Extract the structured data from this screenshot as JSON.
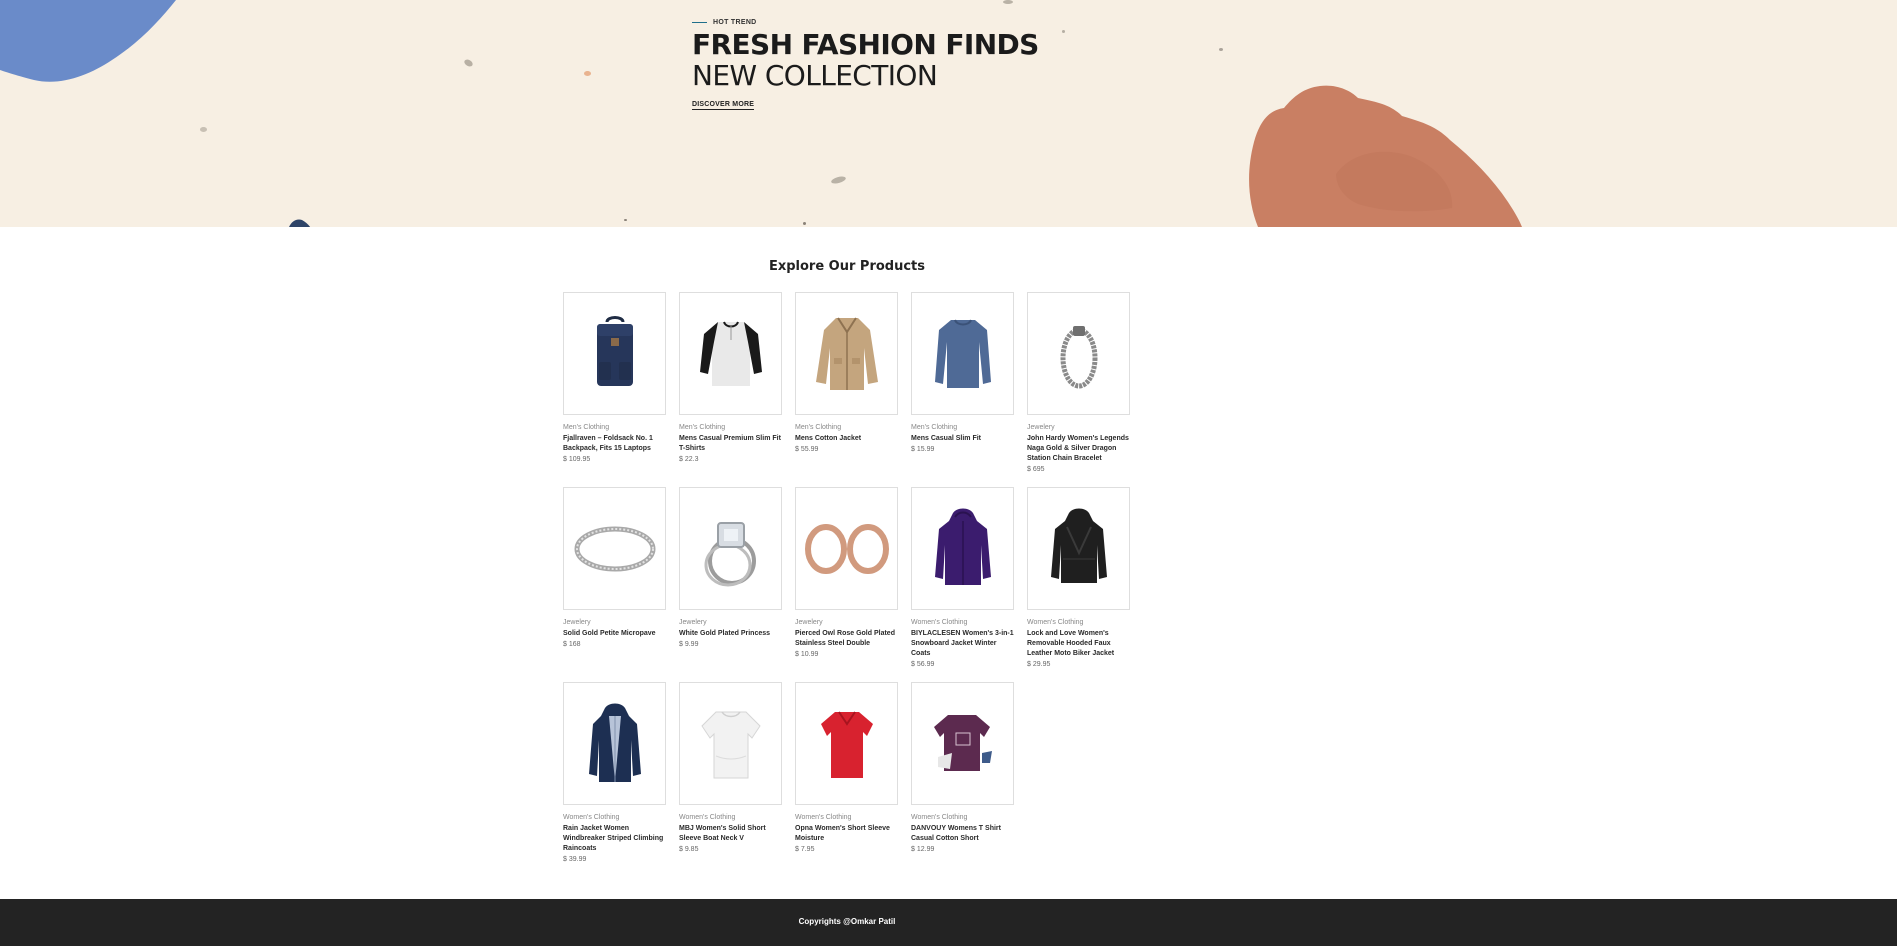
{
  "hero": {
    "tag": "HOT TREND",
    "title_line1": "FRESH FASHION FINDS",
    "title_line2": "NEW COLLECTION",
    "cta_label": "DISCOVER MORE",
    "colors": {
      "background": "#f7efe3",
      "blue_blob": "#6a8bc9",
      "rock": "#c97f63"
    }
  },
  "products": {
    "section_title": "Explore Our Products",
    "items": [
      {
        "category": "Men's Clothing",
        "name": "Fjallraven – Foldsack No. 1 Backpack, Fits 15 Laptops",
        "price": "$ 109.95",
        "icon": "backpack-image"
      },
      {
        "category": "Men's Clothing",
        "name": "Mens Casual Premium Slim Fit T-Shirts",
        "price": "$ 22.3",
        "icon": "raglan-tshirt-image"
      },
      {
        "category": "Men's Clothing",
        "name": "Mens Cotton Jacket",
        "price": "$ 55.99",
        "icon": "cotton-jacket-image"
      },
      {
        "category": "Men's Clothing",
        "name": "Mens Casual Slim Fit",
        "price": "$ 15.99",
        "icon": "longsleeve-shirt-image"
      },
      {
        "category": "Jewelery",
        "name": "John Hardy Women's Legends Naga Gold & Silver Dragon Station Chain Bracelet",
        "price": "$ 695",
        "icon": "bracelet-image"
      },
      {
        "category": "Jewelery",
        "name": "Solid Gold Petite Micropave",
        "price": "$ 168",
        "icon": "ring-band-image"
      },
      {
        "category": "Jewelery",
        "name": "White Gold Plated Princess",
        "price": "$ 9.99",
        "icon": "diamond-ring-image"
      },
      {
        "category": "Jewelery",
        "name": "Pierced Owl Rose Gold Plated Stainless Steel Double",
        "price": "$ 10.99",
        "icon": "plugs-image"
      },
      {
        "category": "Women's Clothing",
        "name": "BIYLACLESEN Women's 3-in-1 Snowboard Jacket Winter Coats",
        "price": "$ 56.99",
        "icon": "purple-jacket-image"
      },
      {
        "category": "Women's Clothing",
        "name": "Lock and Love Women's Removable Hooded Faux Leather Moto Biker Jacket",
        "price": "$ 29.95",
        "icon": "biker-jacket-image"
      },
      {
        "category": "Women's Clothing",
        "name": "Rain Jacket Women Windbreaker Striped Climbing Raincoats",
        "price": "$ 39.99",
        "icon": "rain-jacket-image"
      },
      {
        "category": "Women's Clothing",
        "name": "MBJ Women's Solid Short Sleeve Boat Neck V",
        "price": "$ 9.85",
        "icon": "white-top-image"
      },
      {
        "category": "Women's Clothing",
        "name": "Opna Women's Short Sleeve Moisture",
        "price": "$ 7.95",
        "icon": "red-tshirt-image"
      },
      {
        "category": "Women's Clothing",
        "name": "DANVOUY Womens T Shirt Casual Cotton Short",
        "price": "$ 12.99",
        "icon": "purple-tshirt-image"
      }
    ]
  },
  "footer": {
    "copyright": "Copyrights @Omkar Patil"
  }
}
